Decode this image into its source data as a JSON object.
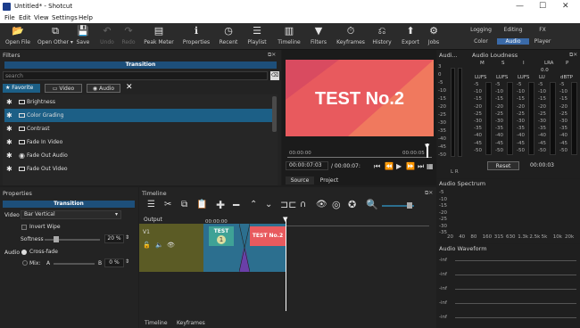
{
  "titlebar": {
    "title": "Untitled* - Shotcut",
    "min": "—",
    "max": "☐",
    "close": "✕"
  },
  "menu": [
    "File",
    "Edit",
    "View",
    "Settings",
    "Help"
  ],
  "toolbar": [
    {
      "icon": "📂",
      "label": "Open File"
    },
    {
      "icon": "⧉",
      "label": "Open Other ▾"
    },
    {
      "icon": "💾",
      "label": "Save"
    },
    {
      "icon": "↶",
      "label": "Undo"
    },
    {
      "icon": "↷",
      "label": "Redo"
    },
    {
      "icon": "▤",
      "label": "Peak Meter"
    },
    {
      "icon": "ℹ",
      "label": "Properties"
    },
    {
      "icon": "◷",
      "label": "Recent"
    },
    {
      "icon": "☰",
      "label": "Playlist"
    },
    {
      "icon": "▥",
      "label": "Timeline"
    },
    {
      "icon": "▼",
      "label": "Filters"
    },
    {
      "icon": "⏱",
      "label": "Keyframes"
    },
    {
      "icon": "⎌",
      "label": "History"
    },
    {
      "icon": "⬆",
      "label": "Export"
    },
    {
      "icon": "⚙",
      "label": "Jobs"
    }
  ],
  "workspaces": {
    "logging": "Logging",
    "editing": "Editing",
    "fx": "FX",
    "color": "Color",
    "audio": "Audio",
    "player": "Player"
  },
  "filters": {
    "title": "Filters",
    "header": "Transition",
    "search_placeholder": "search",
    "tabs": {
      "favorite": "Favorite",
      "video": "Video",
      "audio": "Audio"
    },
    "items": [
      {
        "label": "Brightness",
        "type": "video"
      },
      {
        "label": "Color Grading",
        "type": "video",
        "selected": true
      },
      {
        "label": "Contrast",
        "type": "video"
      },
      {
        "label": "Fade In Video",
        "type": "video"
      },
      {
        "label": "Fade Out Audio",
        "type": "audio"
      },
      {
        "label": "Fade Out Video",
        "type": "video"
      }
    ]
  },
  "preview": {
    "text": "TEST No.2",
    "timecode_left": "00:00:00",
    "timecode_right": "00:00:05",
    "current": "00:00:07:03",
    "total": "/ 00:00:07:",
    "source_tab": "Source",
    "project_tab": "Project"
  },
  "loudness": {
    "title": "Audio Loudness",
    "levels_title": "Audi...",
    "cols": [
      "M",
      "S",
      "I",
      "LRA",
      "P"
    ],
    "vals": [
      "",
      "",
      "",
      "0.0",
      ""
    ],
    "units": [
      "LUFS",
      "LUFS",
      "LUFS",
      "LU",
      "dBTP"
    ],
    "ticks": [
      "-5",
      "-10",
      "-15",
      "-20",
      "-25",
      "-30",
      "-35",
      "-40",
      "-45",
      "-50"
    ],
    "meter_ticks": [
      "3",
      "0",
      "-5",
      "-10",
      "-15",
      "-20",
      "-25",
      "-30",
      "-35",
      "-40",
      "-45",
      "-50"
    ],
    "lr": "L R",
    "reset": "Reset",
    "time": "00:00:03"
  },
  "spectrum": {
    "title": "Audio Spectrum",
    "y": [
      "-5",
      "-10",
      "-15",
      "-20",
      "-25",
      "-30",
      "-35"
    ],
    "x": [
      "20",
      "40",
      "80",
      "160",
      "315",
      "630",
      "1.3k",
      "2.5k",
      "5k",
      "10k",
      "20k"
    ]
  },
  "waveform": {
    "title": "Audio Waveform",
    "labels": [
      "-inf",
      "-inf",
      "-inf",
      "-inf",
      "-inf"
    ]
  },
  "properties": {
    "title": "Properties",
    "header": "Transition",
    "video_label": "Video",
    "video_value": "Bar Vertical",
    "invert": "Invert Wipe",
    "softness_label": "Softness",
    "softness_value": "20 %",
    "audio_label": "Audio",
    "crossfade": "Cross-fade",
    "mix_label": "Mix:",
    "mix_a": "A",
    "mix_b": "B",
    "mix_value": "0 %"
  },
  "timeline": {
    "title": "Timeline",
    "output": "Output",
    "track": "V1",
    "ruler": [
      "00:00:00"
    ],
    "clip1": "TEST",
    "clip1b": "1",
    "clip2": "TEST No.2",
    "tab_timeline": "Timeline",
    "tab_keyframes": "Keyframes"
  },
  "colors": {
    "preview_bg": "#e65a5a",
    "accent": "#1c5f86",
    "clip": "#5b5b25",
    "clip_blue": "#2c6f8f"
  }
}
